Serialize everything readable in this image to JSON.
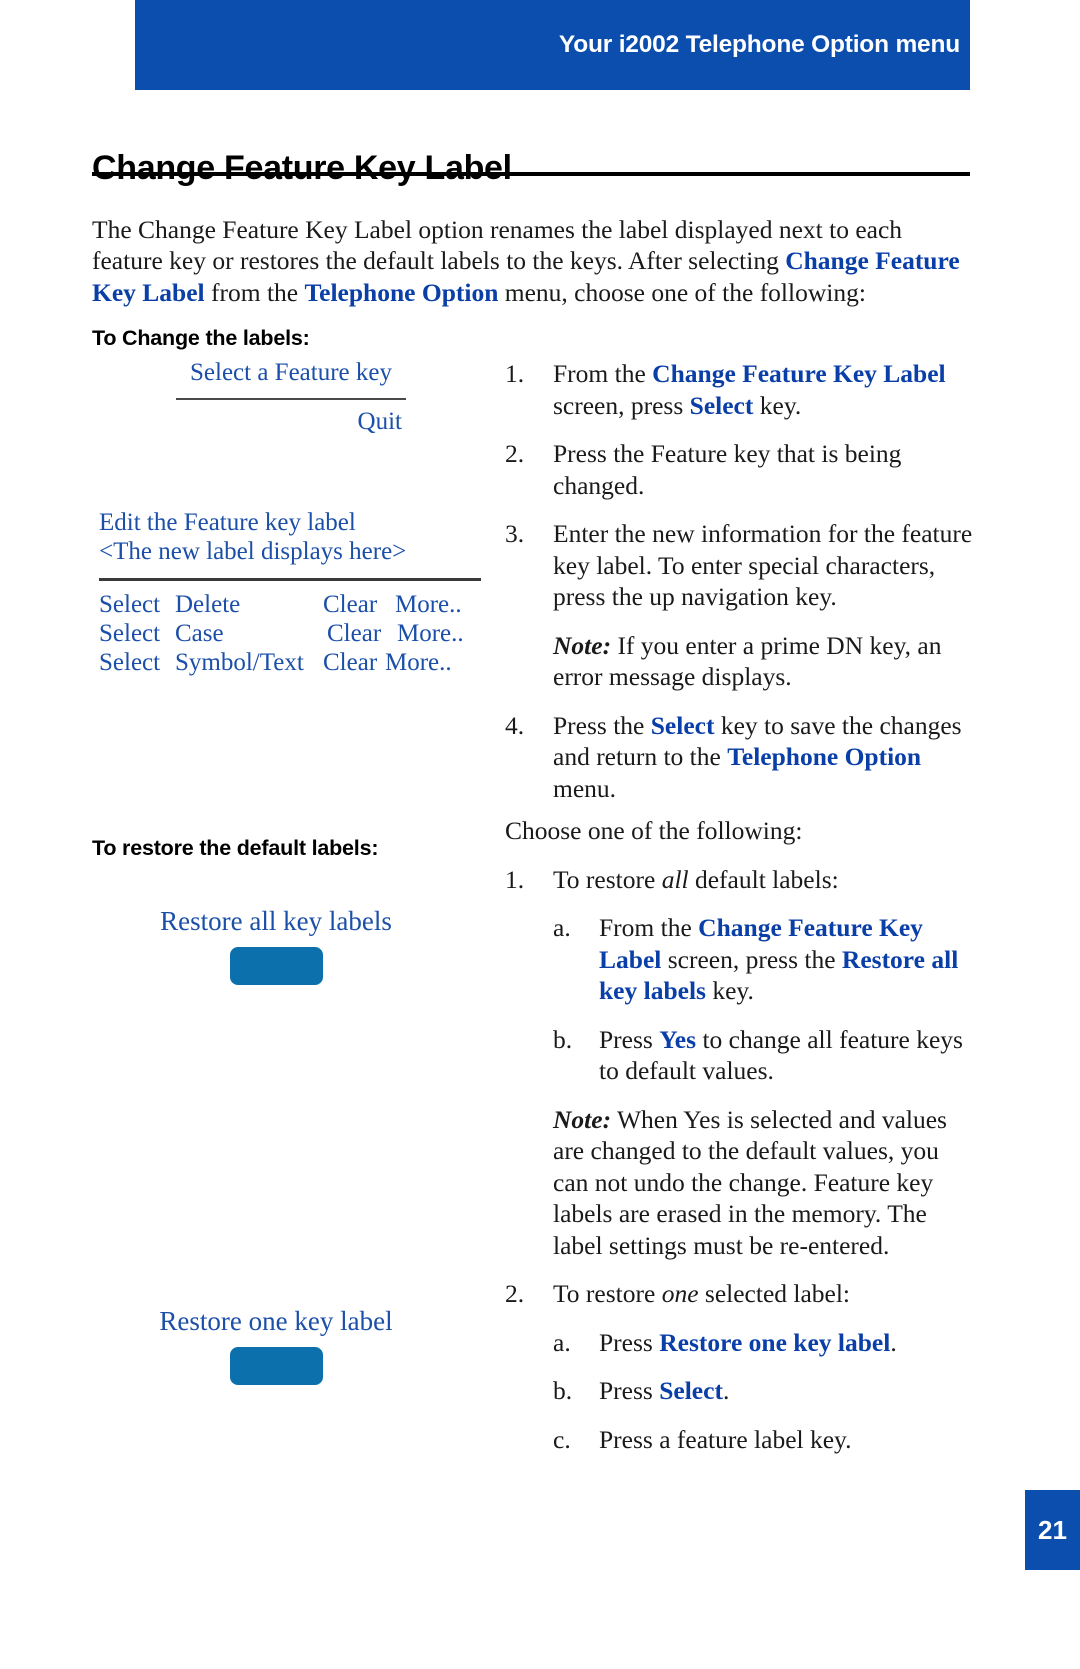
{
  "header": {
    "title": "Your i2002 Telephone Option menu"
  },
  "page": {
    "title": "Change Feature Key Label",
    "number": "21",
    "accent_blue": "#0B4EAE",
    "text_blue": "#0B3FA8",
    "lcd_blue": "#1B4FA8",
    "key_blue": "#0C70AD"
  },
  "intro": {
    "p1_a": "The Change Feature Key Label option renames the label displayed next to each feature key or restores the default labels to the keys. After selecting ",
    "p1_b": "Change Feature Key Label",
    "p1_c": " from the ",
    "p1_d": "Telephone Option",
    "p1_e": " menu, choose one of the following:"
  },
  "sections": {
    "change_heading": "To Change the labels:",
    "restore_heading": "To restore the default labels:"
  },
  "lcd_change_1": {
    "line1": "Select a Feature key",
    "line2": "Quit"
  },
  "lcd_change_2": {
    "line1": "Edit the Feature key label",
    "line2": "<The new label displays here>",
    "softkeys": [
      {
        "a": "Select",
        "b": "Delete",
        "c": "Clear",
        "d": "More.."
      },
      {
        "a": "Select",
        "b": "Case",
        "c": "Clear",
        "d": "More.."
      },
      {
        "a": "Select",
        "b": "Symbol/Text",
        "c": "Clear",
        "d": "More.."
      }
    ]
  },
  "lcd_restore_all": {
    "label": "Restore all key labels"
  },
  "lcd_restore_one": {
    "label": "Restore one key label"
  },
  "proc_change": {
    "step1": {
      "marker": "1.",
      "a": "From the ",
      "b": "Change Feature Key Label",
      "c": " screen, press ",
      "d": "Select",
      "e": " key."
    },
    "step2": {
      "marker": "2.",
      "text": "Press the Feature key that is being changed."
    },
    "step3": {
      "marker": "3.",
      "text": "Enter the new information for the feature key label. To enter special characters, press the up navigation key."
    },
    "note": {
      "label": "Note:",
      "text": " If you enter a prime DN key, an error message displays."
    },
    "step4": {
      "marker": "4.",
      "a": "Press the ",
      "b": "Select",
      "c": " key to save the changes and return to the ",
      "d": "Telephone Option",
      "e": " menu."
    }
  },
  "proc_restore": {
    "lead": "Choose one of the following:",
    "step1": {
      "marker": "1.",
      "a": "To restore ",
      "b": "all",
      "c": " default labels:"
    },
    "step1a": {
      "marker": "a.",
      "a": "From the ",
      "b": "Change Feature Key Label",
      "c": " screen, press the ",
      "d": "Restore all key labels",
      "e": " key."
    },
    "step1b": {
      "marker": "b.",
      "a": "Press ",
      "b": "Yes",
      "c": " to change all feature keys to default values."
    },
    "note": {
      "label": "Note:",
      "text": " When Yes is selected and values are changed to the default values, you can not undo the change. Feature key labels are erased in the memory. The label settings must be re-entered."
    },
    "step2": {
      "marker": "2.",
      "a": "To restore ",
      "b": "one",
      "c": " selected label:"
    },
    "step2a": {
      "marker": "a.",
      "a": "Press ",
      "b": "Restore one key label",
      "c": "."
    },
    "step2b": {
      "marker": "b.",
      "a": "Press ",
      "b": "Select",
      "c": "."
    },
    "step2c": {
      "marker": "c.",
      "text": "Press a feature label key."
    }
  }
}
